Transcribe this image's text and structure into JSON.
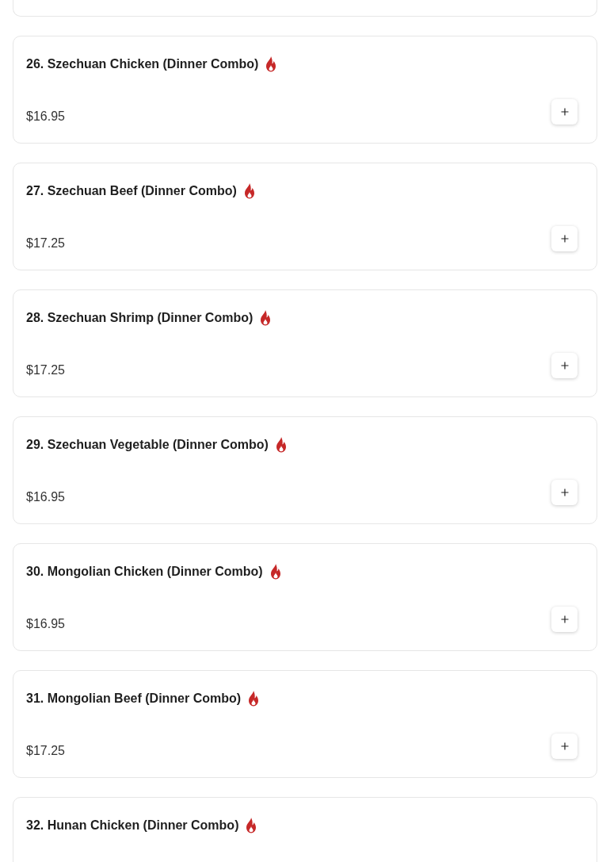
{
  "menu_items": [
    {
      "name": "26. Szechuan Chicken (Dinner Combo)",
      "spicy": true,
      "price": "$16.95"
    },
    {
      "name": "27. Szechuan Beef (Dinner Combo)",
      "spicy": true,
      "price": "$17.25"
    },
    {
      "name": "28. Szechuan Shrimp (Dinner Combo)",
      "spicy": true,
      "price": "$17.25"
    },
    {
      "name": "29. Szechuan Vegetable (Dinner Combo)",
      "spicy": true,
      "price": "$16.95"
    },
    {
      "name": "30. Mongolian Chicken (Dinner Combo)",
      "spicy": true,
      "price": "$16.95"
    },
    {
      "name": "31. Mongolian Beef (Dinner Combo)",
      "spicy": true,
      "price": "$17.25"
    },
    {
      "name": "32. Hunan Chicken (Dinner Combo)",
      "spicy": true
    }
  ]
}
